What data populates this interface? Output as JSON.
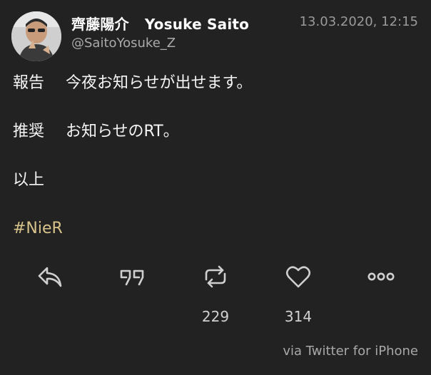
{
  "author": {
    "name_jp": "齊藤陽介",
    "name_en": "Yosuke Saito",
    "handle": "@SaitoYosuke_Z",
    "avatar_icon": "profile-photo"
  },
  "timestamp": "13.03.2020, 12:15",
  "body": {
    "line1_label": "報告",
    "line1_text": "今夜お知らせが出せます。",
    "line2_label": "推奨",
    "line2_text": "お知らせのRT。",
    "line3_text": "以上",
    "hashtag": "#NieR"
  },
  "actions": {
    "reply_icon": "reply-icon",
    "quote_icon": "quote-icon",
    "retweet_icon": "retweet-icon",
    "like_icon": "heart-icon",
    "more_icon": "more-icon"
  },
  "counts": {
    "retweets": "229",
    "likes": "314"
  },
  "source": "via Twitter for iPhone",
  "colors": {
    "background": "#222222",
    "text": "#f5f5f5",
    "hashtag": "#d7c28a",
    "muted": "#9a9a9a"
  }
}
